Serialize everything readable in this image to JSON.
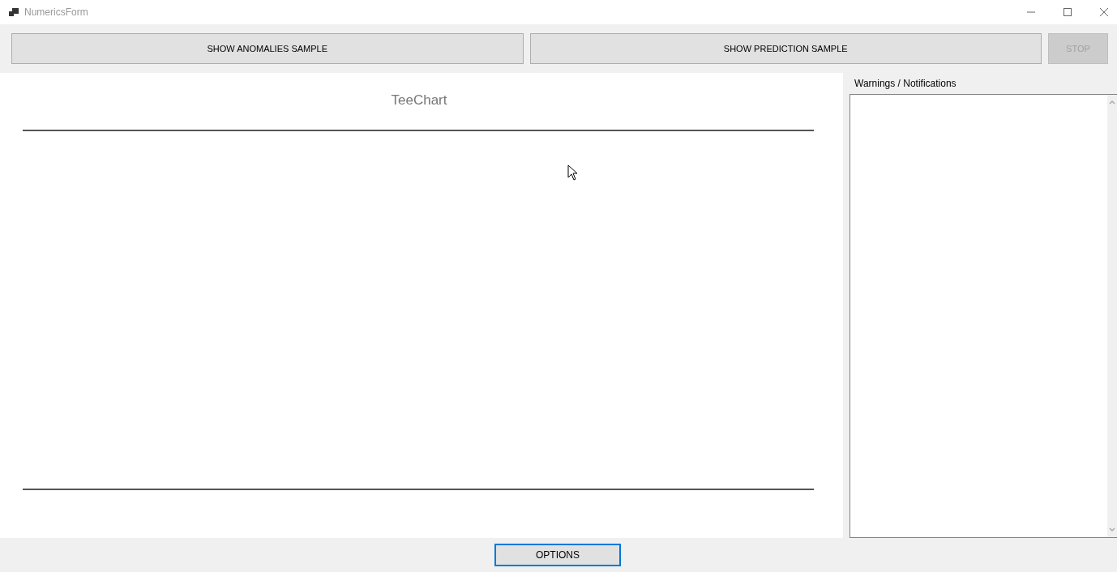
{
  "window": {
    "title": "NumericsForm"
  },
  "toolbar": [
    {
      "label": "SHOW ANOMALIES SAMPLE",
      "disabled": false
    },
    {
      "label": "SHOW PREDICTION SAMPLE",
      "disabled": false
    },
    {
      "label": "STOP",
      "disabled": true
    }
  ],
  "chart": {
    "title": "TeeChart"
  },
  "notifications": {
    "label": "Warnings / Notifications"
  },
  "footer": {
    "button": {
      "label": "OPTIONS",
      "focused": true
    }
  }
}
